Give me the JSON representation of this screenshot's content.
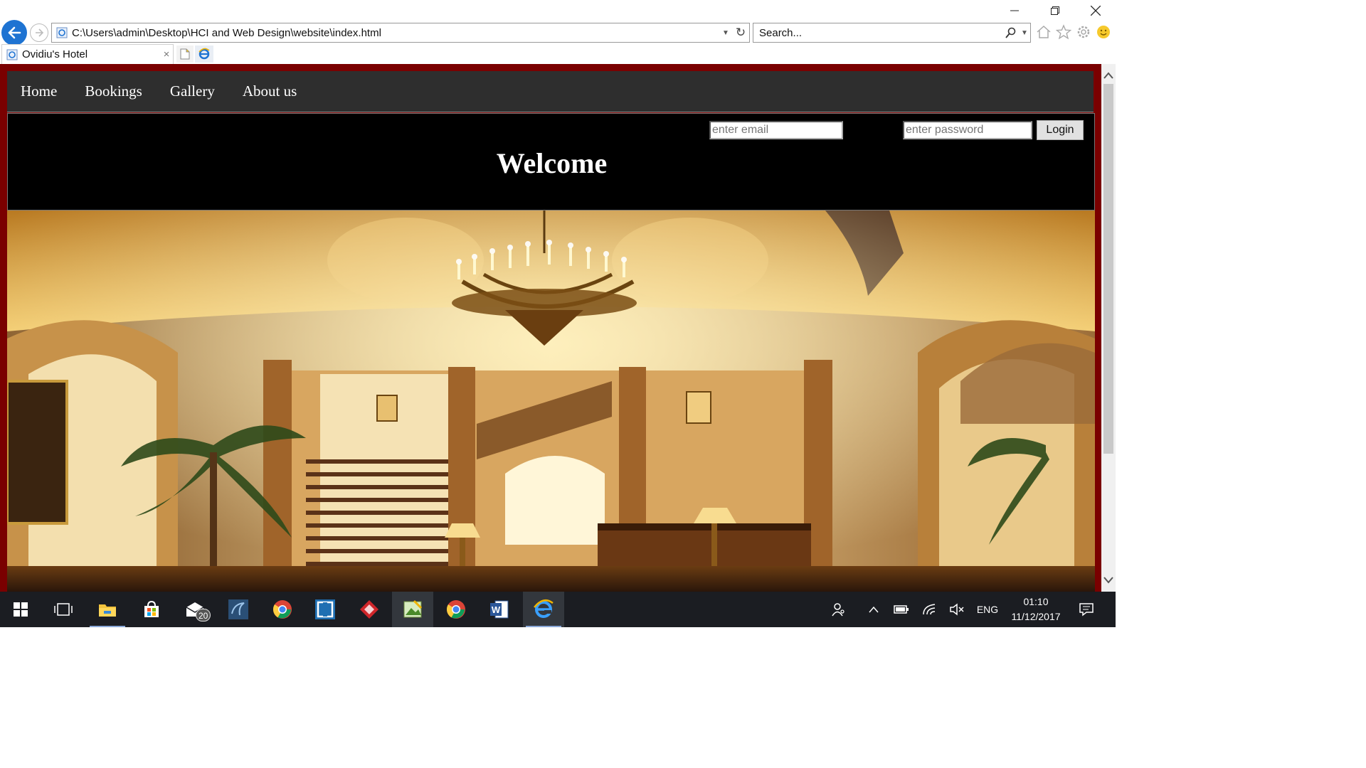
{
  "browser": {
    "address": "C:\\Users\\admin\\Desktop\\HCI and Web Design\\website\\index.html",
    "search_placeholder": "Search...",
    "tab_title": "Ovidiu's Hotel",
    "tab_close": "×"
  },
  "site": {
    "nav": [
      "Home",
      "Bookings",
      "Gallery",
      "About us"
    ],
    "email_placeholder": "enter email",
    "password_placeholder": "enter password",
    "login_label": "Login",
    "welcome": "Welcome"
  },
  "taskbar": {
    "mail_badge": "20",
    "language": "ENG",
    "time": "01:10",
    "date": "11/12/2017"
  },
  "colors": {
    "page_border": "#7a0000",
    "nav_bg": "#2e2e2e",
    "header_bg": "#000000",
    "ie_blue": "#1e73d2"
  }
}
